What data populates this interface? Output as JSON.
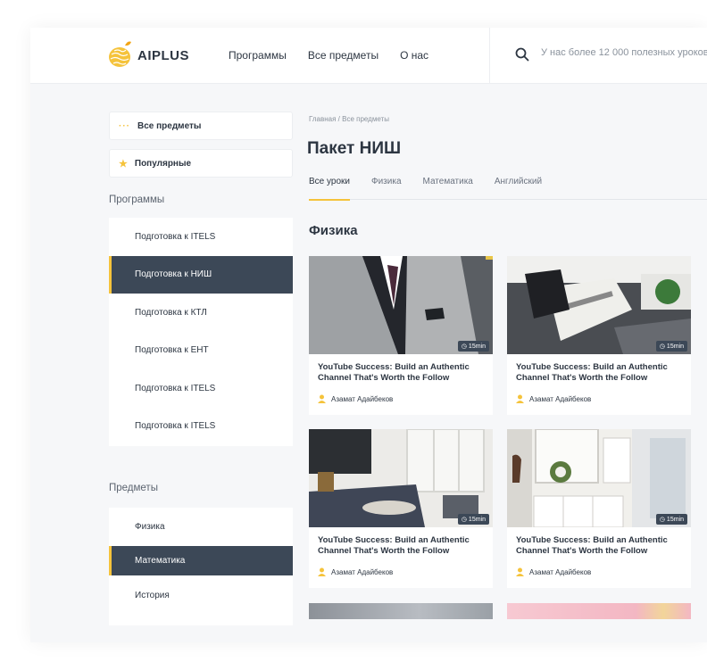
{
  "header": {
    "logo_text": "AIPLUS",
    "nav": [
      "Программы",
      "Все предметы",
      "О нас"
    ],
    "search_placeholder": "У нас более 12 000 полезных уроков"
  },
  "sidebar": {
    "all_subjects": "Все предметы",
    "popular": "Популярные",
    "programs_title": "Программы",
    "programs": [
      {
        "label": "Подготовка к ITELS",
        "active": false
      },
      {
        "label": "Подготовка к НИШ",
        "active": true
      },
      {
        "label": "Подготовка к КТЛ",
        "active": false
      },
      {
        "label": "Подготовка к ЕНТ",
        "active": false
      },
      {
        "label": "Подготовка к ITELS",
        "active": false
      },
      {
        "label": "Подготовка к ITELS",
        "active": false
      }
    ],
    "subjects_title": "Предметы",
    "subjects": [
      {
        "label": "Физика",
        "active": false
      },
      {
        "label": "Математика",
        "active": true
      },
      {
        "label": "История",
        "active": false
      }
    ]
  },
  "main": {
    "breadcrumb": "Главная / Все предметы",
    "title": "Пакет НИШ",
    "tabs": [
      "Все уроки",
      "Физика",
      "Математика",
      "Английский"
    ],
    "category_title": "Физика",
    "cards": [
      {
        "image": "suit",
        "duration": "15min",
        "title": "YouTube Success: Build an Authentic Channel That's Worth the Follow",
        "author": "Азамат Адайбеков"
      },
      {
        "image": "newspaper",
        "duration": "15min",
        "title": "YouTube Success: Build an Authentic Channel That's Worth the Follow",
        "author": "Азамат Адайбеков"
      },
      {
        "image": "living-room",
        "duration": "15min",
        "title": "YouTube Success: Build an Authentic Channel That's Worth the Follow",
        "author": "Азамат Адайбеков"
      },
      {
        "image": "hallway",
        "duration": "15min",
        "title": "YouTube Success: Build an Authentic Channel That's Worth the Follow",
        "author": "Азамат Адайбеков"
      }
    ]
  },
  "colors": {
    "accent": "#f5c33b",
    "dark": "#3c4857",
    "text": "#2d3642"
  }
}
